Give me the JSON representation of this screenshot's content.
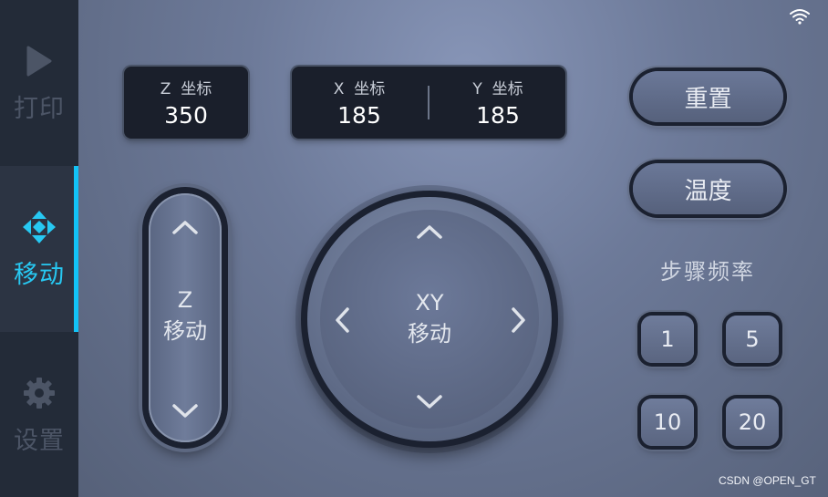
{
  "sidebar": {
    "items": [
      {
        "label": "打印",
        "icon": "play-icon"
      },
      {
        "label": "移动",
        "icon": "move-arrows-icon",
        "active": true
      },
      {
        "label": "设置",
        "icon": "gear-icon"
      }
    ]
  },
  "coords": {
    "z": {
      "label": "Z  坐标",
      "value": "350"
    },
    "x": {
      "label": "X  坐标",
      "value": "185"
    },
    "y": {
      "label": "Y  坐标",
      "value": "185"
    }
  },
  "controls": {
    "z_line1": "Z",
    "z_line2": "移动",
    "xy_line1": "XY",
    "xy_line2": "移动"
  },
  "actions": {
    "reset": "重置",
    "temperature": "温度"
  },
  "step": {
    "title": "步骤频率",
    "options": [
      "1",
      "5",
      "10",
      "20"
    ]
  },
  "watermark": "CSDN @OPEN_GT",
  "colors": {
    "accent": "#12c3f7",
    "sidebar_bg": "#232b38",
    "panel_bg": "#1a1f2b"
  }
}
